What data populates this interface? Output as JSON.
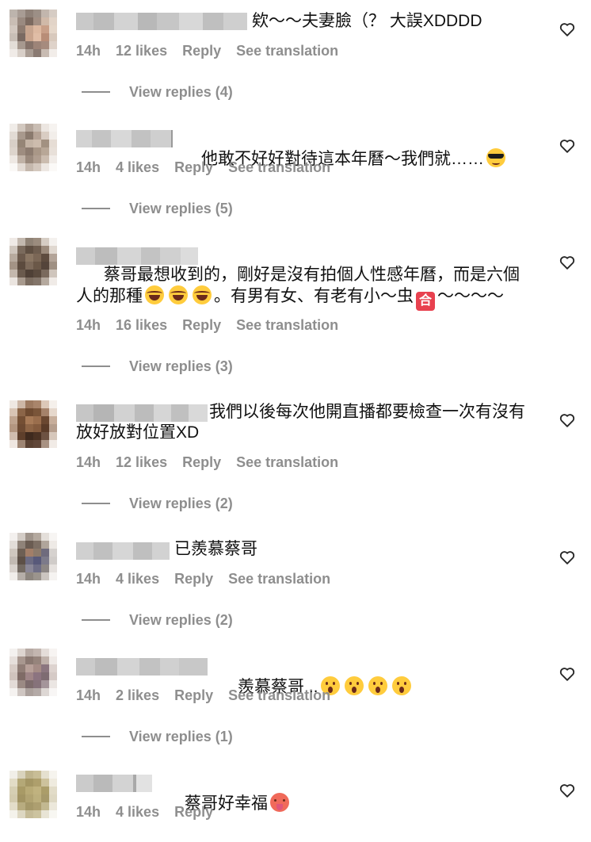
{
  "comments": [
    {
      "text": "欸～～夫妻臉（？ 大誤XDDDD",
      "time": "14h",
      "likes": "12 likes",
      "reply": "Reply",
      "translation": "See translation",
      "view_replies": "View replies (4)"
    },
    {
      "text": "他敢不好好對待這本年曆～我們就……",
      "emoji": "smiling-face-with-sunglasses",
      "time": "14h",
      "likes": "4 likes",
      "reply": "Reply",
      "translation": "See translation",
      "view_replies": "View replies (5)"
    },
    {
      "text_a": "蔡哥最想收到的，剛好是沒有拍個人性感年曆，而是六個人的那種",
      "text_b": "。有男有女、有老有小～虫",
      "text_c": "～～～～",
      "emoji": "face-with-tears-of-joy",
      "sign": "合",
      "time": "14h",
      "likes": "16 likes",
      "reply": "Reply",
      "translation": "See translation",
      "view_replies": "View replies (3)"
    },
    {
      "text": "我們以後每次他開直播都要檢查一次有沒有放好放對位置XD",
      "time": "14h",
      "likes": "12 likes",
      "reply": "Reply",
      "translation": "See translation",
      "view_replies": "View replies (2)"
    },
    {
      "text": "已羨慕蔡哥",
      "time": "14h",
      "likes": "4 likes",
      "reply": "Reply",
      "translation": "See translation",
      "view_replies": "View replies (2)"
    },
    {
      "text": "羨慕蔡哥...",
      "emoji": "face-with-open-mouth",
      "time": "14h",
      "likes": "2 likes",
      "reply": "Reply",
      "translation": "See translation",
      "view_replies": "View replies (1)"
    },
    {
      "text": "蔡哥好幸福",
      "emoji": "hot-face",
      "time": "14h",
      "likes": "4 likes",
      "reply": "Reply"
    }
  ],
  "icons": {
    "like": "heart-outline-icon"
  },
  "colors": {
    "meta_text": "#8e8e8e",
    "comment_text": "#111111",
    "background": "#ffffff"
  }
}
